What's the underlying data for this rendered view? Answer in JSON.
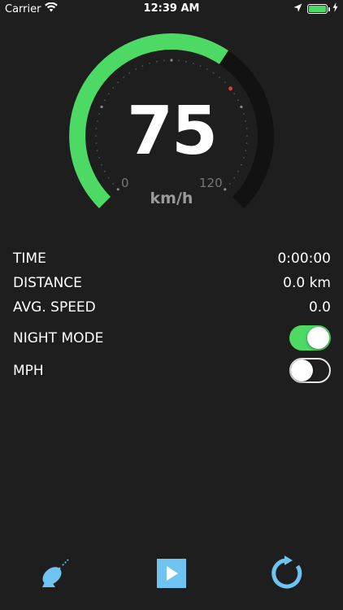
{
  "status_bar": {
    "carrier": "Carrier",
    "time": "12:39 AM",
    "icons": [
      "wifi-icon",
      "location-arrow-icon",
      "battery-icon",
      "charging-bolt-icon"
    ],
    "battery_level": 1.0
  },
  "gauge": {
    "speed": "75",
    "unit": "km/h",
    "min_label": "0",
    "max_label": "120",
    "speed_fraction": 0.625,
    "accent_color": "#4cd964",
    "marker_color": "#e53935"
  },
  "stats": {
    "time_label": "TIME",
    "time_value": "0:00:00",
    "distance_label": "DISTANCE",
    "distance_value": "0.0 km",
    "avg_speed_label": "AVG. SPEED",
    "avg_speed_value": "0.0"
  },
  "toggles": {
    "night_mode_label": "NIGHT MODE",
    "night_mode_on": true,
    "mph_label": "MPH",
    "mph_on": false
  },
  "toolbar": {
    "icons": [
      "satellite-dish-icon",
      "play-icon",
      "reset-icon"
    ],
    "icon_color": "#6ec3f0"
  }
}
